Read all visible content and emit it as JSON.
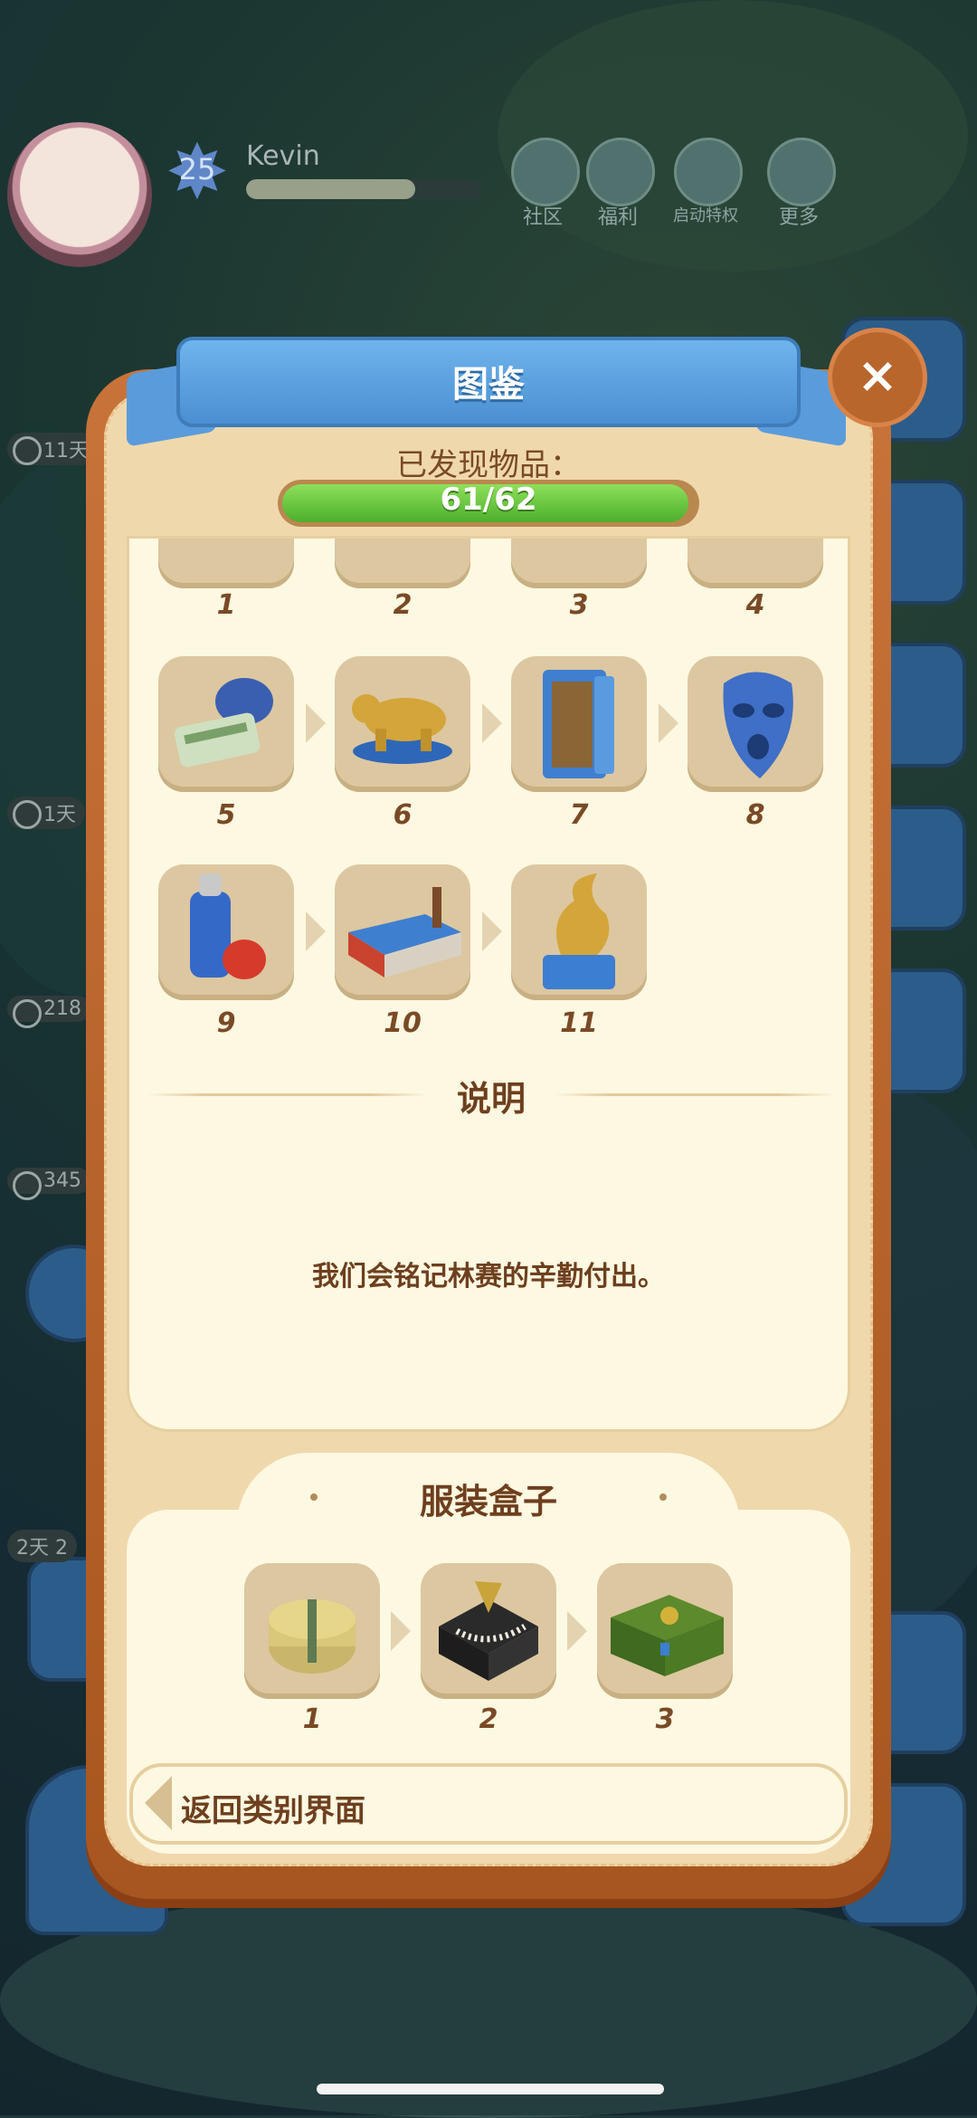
{
  "player": {
    "level": "25",
    "name": "Kevin",
    "xp_fraction": 0.72
  },
  "top_menu": [
    {
      "label": "社区",
      "icon": "community-icon"
    },
    {
      "label": "福利",
      "icon": "gift-icon"
    },
    {
      "label": "启动特权",
      "icon": "wechat-icon"
    },
    {
      "label": "更多",
      "icon": "more-icon"
    }
  ],
  "side_timers": [
    "11天",
    "1天",
    "218",
    "345",
    "2天 2"
  ],
  "modal": {
    "title": "图鉴",
    "found_label": "已发现物品：",
    "progress_text": "61/62",
    "progress_fraction": 0.984,
    "top_row_numbers": [
      "1",
      "2",
      "3",
      "4"
    ],
    "items": [
      {
        "num": "5",
        "icon": "money-bag-icon"
      },
      {
        "num": "6",
        "icon": "golden-bear-icon"
      },
      {
        "num": "7",
        "icon": "safe-icon"
      },
      {
        "num": "8",
        "icon": "blue-mask-icon"
      },
      {
        "num": "9",
        "icon": "spray-can-icon"
      },
      {
        "num": "10",
        "icon": "factory-icon"
      },
      {
        "num": "11",
        "icon": "golden-trophy-icon"
      }
    ],
    "description_title": "说明",
    "description_text": "我们会铭记林赛的辛勤付出。",
    "next_category": {
      "title": "服装盒子",
      "items": [
        {
          "num": "1",
          "icon": "round-hat-box-icon"
        },
        {
          "num": "2",
          "icon": "jewelry-box-icon"
        },
        {
          "num": "3",
          "icon": "green-chest-icon"
        }
      ]
    },
    "back_label": "返回类别界面",
    "close_glyph": "×"
  },
  "colors": {
    "accent_blue": "#4a8fd2",
    "panel_cream": "#fdf8e1",
    "frame_orange": "#c8733a",
    "progress_green": "#4caf2b",
    "text_brown": "#6e3f1e"
  }
}
